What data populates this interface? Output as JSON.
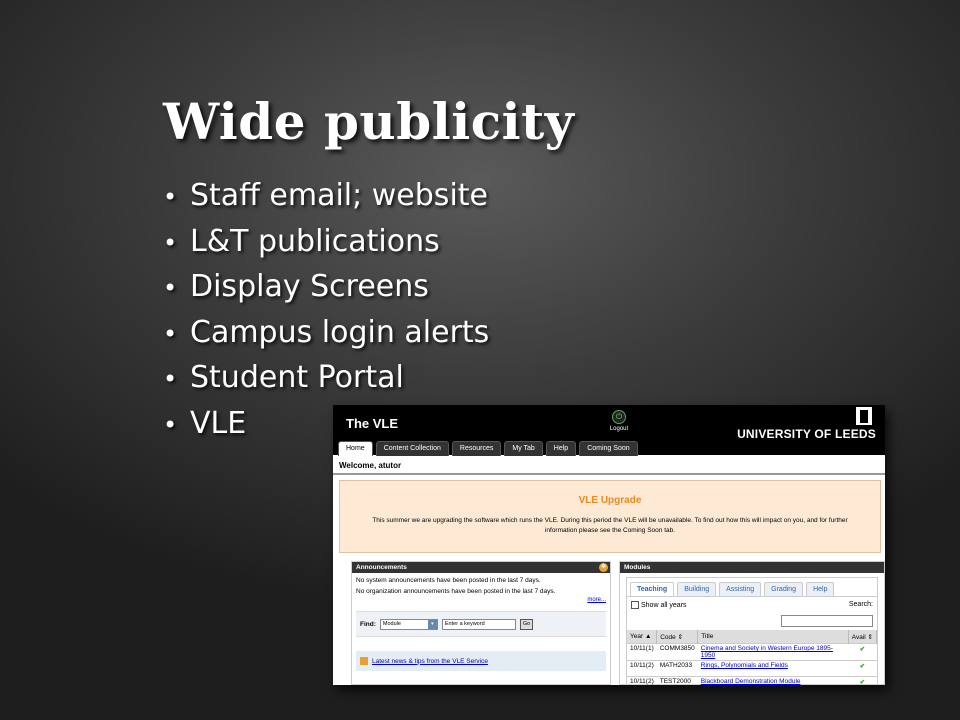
{
  "slide": {
    "title": "Wide publicity",
    "bullets": [
      "Staff email; website",
      "L&T publications",
      "Display Screens",
      "Campus login alerts",
      "Student Portal",
      "VLE"
    ]
  },
  "vle": {
    "title": "The VLE",
    "logout_label": "Logout",
    "university": "UNIVERSITY OF LEEDS",
    "tabs": [
      "Home",
      "Content Collection",
      "Resources",
      "My Tab",
      "Help",
      "Coming Soon"
    ],
    "active_tab": "Home",
    "welcome": "Welcome, atutor",
    "upgrade": {
      "title": "VLE Upgrade",
      "text_line1": "This summer we are upgrading the software which runs the VLE. During this period the VLE will be unavailable. To find out how this will impact on you, and for further",
      "text_line2": "information please see the Coming Soon tab."
    },
    "announcements": {
      "header": "Announcements",
      "line1": "No system announcements have been posted in the last 7 days.",
      "line2": "No organization announcements have been posted in the last 7 days.",
      "more": "more...",
      "find_label": "Find:",
      "find_select": "Module",
      "keyword_placeholder": "Enter a keyword",
      "go": "Go",
      "news_link": "Latest news & tips from the VLE Service"
    },
    "modules": {
      "header": "Modules",
      "tabs": [
        "Teaching",
        "Building",
        "Assisting",
        "Grading",
        "Help"
      ],
      "show_all": "Show all years",
      "search_label": "Search:",
      "columns": [
        "Year",
        "Code",
        "Title",
        "Avail"
      ],
      "rows": [
        {
          "year": "10/11(1)",
          "code": "COMM3850",
          "title": "Cinema and Society in Western Europe 1895-1950",
          "avail": "✔"
        },
        {
          "year": "10/11(2)",
          "code": "MATH2033",
          "title": "Rings, Polynomials and Fields",
          "avail": "✔"
        },
        {
          "year": "10/11(2)",
          "code": "TEST2000",
          "title": "Blackboard Demonstration Module",
          "avail": "✔"
        }
      ]
    }
  }
}
